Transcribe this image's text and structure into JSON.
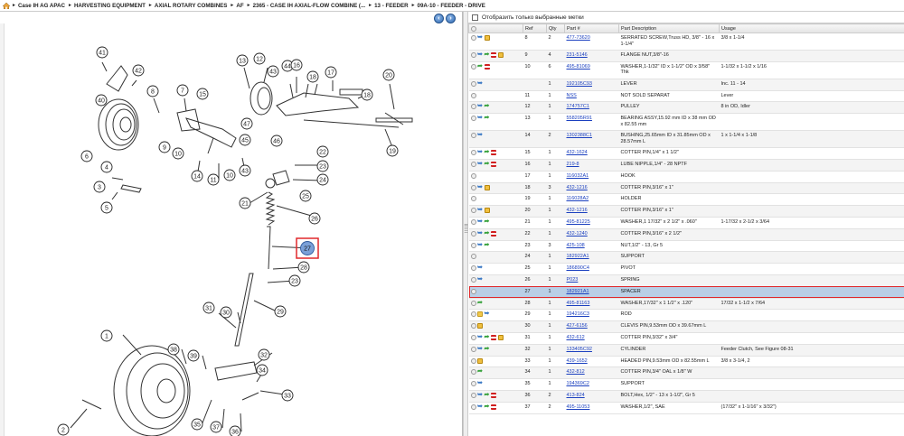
{
  "breadcrumb": {
    "items": [
      "Case IH AG APAC",
      "HARVESTING EQUIPMENT",
      "AXIAL ROTARY COMBINES",
      "AF",
      "2365 - CASE IH AXIAL-FLOW COMBINE (...",
      "13 - FEEDER",
      "09A-10 - FEEDER - DRIVE"
    ],
    "separator": "►"
  },
  "filter": {
    "label": "Отобразить только выбранные метки"
  },
  "table": {
    "headers": [
      "",
      "Ref",
      "Qty",
      "Part #",
      "Part Description",
      "Usage"
    ],
    "rows": [
      {
        "icons": [
          "circle",
          "share",
          "pkg"
        ],
        "ref": "8",
        "qty": "2",
        "part": "477-73620",
        "desc": "SERRATED SCREW,Truss HD, 3/8\" - 16 x 1-1/4\"",
        "usage": "3/8 x 1-1/4",
        "tall": true
      },
      {
        "icons": [
          "circle",
          "share",
          "cart",
          "doc",
          "pkg"
        ],
        "ref": "9",
        "qty": "4",
        "part": "231-5146",
        "desc": "FLANGE NUT,3/8\"-16",
        "usage": "",
        "tall": false
      },
      {
        "icons": [
          "circle",
          "cart",
          "doc"
        ],
        "ref": "10",
        "qty": "6",
        "part": "495-81069",
        "desc": "WASHER,1-1/32\" ID x 1-1/2\" OD x 3/58\" Thk",
        "usage": "1-1/32 x 1-1/2 x 1/16",
        "tall": true
      },
      {
        "icons": [
          "circle",
          "share"
        ],
        "ref": "",
        "qty": "1",
        "part": "192105C93",
        "desc": "LEVER",
        "usage": "Inc. 11 - 14",
        "tall": false
      },
      {
        "icons": [
          "circle"
        ],
        "ref": "11",
        "qty": "1",
        "part": "NSS",
        "desc": "NOT SOLD SEPARAT",
        "usage": "Lever",
        "tall": false
      },
      {
        "icons": [
          "circle",
          "share",
          "cart"
        ],
        "ref": "12",
        "qty": "1",
        "part": "174757C1",
        "desc": "PULLEY",
        "usage": "8 in OD, Idler",
        "tall": false
      },
      {
        "icons": [
          "circle",
          "share",
          "cart"
        ],
        "ref": "13",
        "qty": "1",
        "part": "558205R91",
        "desc": "BEARING ASSY,15.92 mm ID x 38 mm OD x 82.55 mm",
        "usage": "",
        "tall": true
      },
      {
        "icons": [
          "circle",
          "share"
        ],
        "ref": "14",
        "qty": "2",
        "part": "1302388C1",
        "desc": "BUSHING,25.65mm ID x 31.85mm OD x 28.57mm L",
        "usage": "1 x 1-1/4 x 1-1/8",
        "tall": true
      },
      {
        "icons": [
          "circle",
          "share",
          "cart",
          "doc"
        ],
        "ref": "15",
        "qty": "1",
        "part": "432-1624",
        "desc": "COTTER PIN,1/4\" x 1 1/2\"",
        "usage": "",
        "tall": false
      },
      {
        "icons": [
          "circle",
          "share",
          "cart",
          "doc"
        ],
        "ref": "16",
        "qty": "1",
        "part": "219-8",
        "desc": "LUBE NIPPLE,1/4\" - 28 NPTF",
        "usage": "",
        "tall": false
      },
      {
        "icons": [
          "circle"
        ],
        "ref": "17",
        "qty": "1",
        "part": "116032A1",
        "desc": "HOOK",
        "usage": "",
        "tall": false
      },
      {
        "icons": [
          "circle",
          "share",
          "pkg"
        ],
        "ref": "18",
        "qty": "3",
        "part": "432-1216",
        "desc": "COTTER PIN,3/16\" x 1\"",
        "usage": "",
        "tall": false
      },
      {
        "icons": [
          "circle"
        ],
        "ref": "19",
        "qty": "1",
        "part": "116028A2",
        "desc": "HOLDER",
        "usage": "",
        "tall": false
      },
      {
        "icons": [
          "circle",
          "share",
          "pkg"
        ],
        "ref": "20",
        "qty": "1",
        "part": "432-1216",
        "desc": "COTTER PIN,3/16\" x 1\"",
        "usage": "",
        "tall": false
      },
      {
        "icons": [
          "circle",
          "share",
          "cart"
        ],
        "ref": "21",
        "qty": "1",
        "part": "495-81225",
        "desc": "WASHER,1 17/32\" x 2 1/2\" x .060\"",
        "usage": "1-17/32 x 2-1/2 x 3/64",
        "tall": false
      },
      {
        "icons": [
          "circle",
          "share",
          "cart",
          "doc"
        ],
        "ref": "22",
        "qty": "1",
        "part": "432-1240",
        "desc": "COTTER PIN,3/16\" x 2 1/2\"",
        "usage": "",
        "tall": false
      },
      {
        "icons": [
          "circle",
          "share",
          "cart"
        ],
        "ref": "23",
        "qty": "3",
        "part": "425-108",
        "desc": "NUT,1/2\" - 13, Gr 5",
        "usage": "",
        "tall": false
      },
      {
        "icons": [
          "circle"
        ],
        "ref": "24",
        "qty": "1",
        "part": "182922A1",
        "desc": "SUPPORT",
        "usage": "",
        "tall": false
      },
      {
        "icons": [
          "circle",
          "share"
        ],
        "ref": "25",
        "qty": "1",
        "part": "186890C4",
        "desc": "PIVOT",
        "usage": "",
        "tall": false
      },
      {
        "icons": [
          "circle",
          "share"
        ],
        "ref": "26",
        "qty": "1",
        "part": "P023",
        "desc": "SPRING",
        "usage": "",
        "tall": false
      },
      {
        "icons": [
          "circle"
        ],
        "ref": "27",
        "qty": "1",
        "part": "182921A1",
        "desc": "SPACER",
        "usage": "",
        "tall": false,
        "selected": true
      },
      {
        "icons": [
          "circle",
          "cart"
        ],
        "ref": "28",
        "qty": "1",
        "part": "495-81163",
        "desc": "WASHER,17/32\" x 1 1/2\" x .120\"",
        "usage": "17/32 x 1-1/2 x 7/64",
        "tall": false
      },
      {
        "icons": [
          "circle",
          "folder",
          "share"
        ],
        "ref": "29",
        "qty": "1",
        "part": "194216C3",
        "desc": "ROD",
        "usage": "",
        "tall": false
      },
      {
        "icons": [
          "circle",
          "pkg"
        ],
        "ref": "30",
        "qty": "1",
        "part": "427-6156",
        "desc": "CLEVIS PIN,9.53mm OD x 39.67mm L",
        "usage": "",
        "tall": false
      },
      {
        "icons": [
          "circle",
          "share",
          "cart",
          "doc",
          "pkg"
        ],
        "ref": "31",
        "qty": "1",
        "part": "432-612",
        "desc": "COTTER PIN,3/32\" x 3/4\"",
        "usage": "",
        "tall": false
      },
      {
        "icons": [
          "circle",
          "share",
          "cart"
        ],
        "ref": "32",
        "qty": "1",
        "part": "133405C92",
        "desc": "CYLINDER",
        "usage": "Feeder Clutch, See Figure 08-31",
        "tall": false
      },
      {
        "icons": [
          "circle",
          "pkg"
        ],
        "ref": "33",
        "qty": "1",
        "part": "439-1652",
        "desc": "HEADED PIN,9.53mm OD x 82.55mm L",
        "usage": "3/8 x 3-1/4, 2",
        "tall": false
      },
      {
        "icons": [
          "circle",
          "cart"
        ],
        "ref": "34",
        "qty": "1",
        "part": "432-812",
        "desc": "COTTER PIN,3/4\" OAL x 1/8\" W",
        "usage": "",
        "tall": false
      },
      {
        "icons": [
          "circle",
          "share"
        ],
        "ref": "35",
        "qty": "1",
        "part": "194369C2",
        "desc": "SUPPORT",
        "usage": "",
        "tall": false
      },
      {
        "icons": [
          "circle",
          "share",
          "cart",
          "doc"
        ],
        "ref": "36",
        "qty": "2",
        "part": "413-824",
        "desc": "BOLT,Hex, 1/2\" - 13 x 1-1/2\", Gr 5",
        "usage": "",
        "tall": false
      },
      {
        "icons": [
          "circle",
          "share",
          "cart",
          "doc"
        ],
        "ref": "37",
        "qty": "2",
        "part": "495-11053",
        "desc": "WASHER,1/2\", SAE",
        "usage": "(17/32\" x 1-1/16\" x 3/32\")",
        "tall": false
      }
    ]
  },
  "diagram": {
    "callouts": [
      "41",
      "42",
      "40",
      "8",
      "7",
      "15",
      "13",
      "12",
      "43",
      "44",
      "16",
      "18",
      "17",
      "20",
      "6",
      "9",
      "10",
      "47",
      "45",
      "46",
      "14",
      "11",
      "10",
      "43",
      "22",
      "23",
      "24",
      "19",
      "18",
      "4",
      "3",
      "5",
      "21",
      "25",
      "26",
      "27",
      "28",
      "23",
      "29",
      "31",
      "30",
      "1",
      "38",
      "39",
      "32",
      "34",
      "33",
      "2",
      "35",
      "37",
      "36"
    ],
    "highlighted": "27"
  },
  "colors": {
    "link": "#1a3fbf",
    "selected_row": "#b9cfe6",
    "highlight_border": "#e0282b",
    "highlight_fill": "#7aa0d8"
  }
}
